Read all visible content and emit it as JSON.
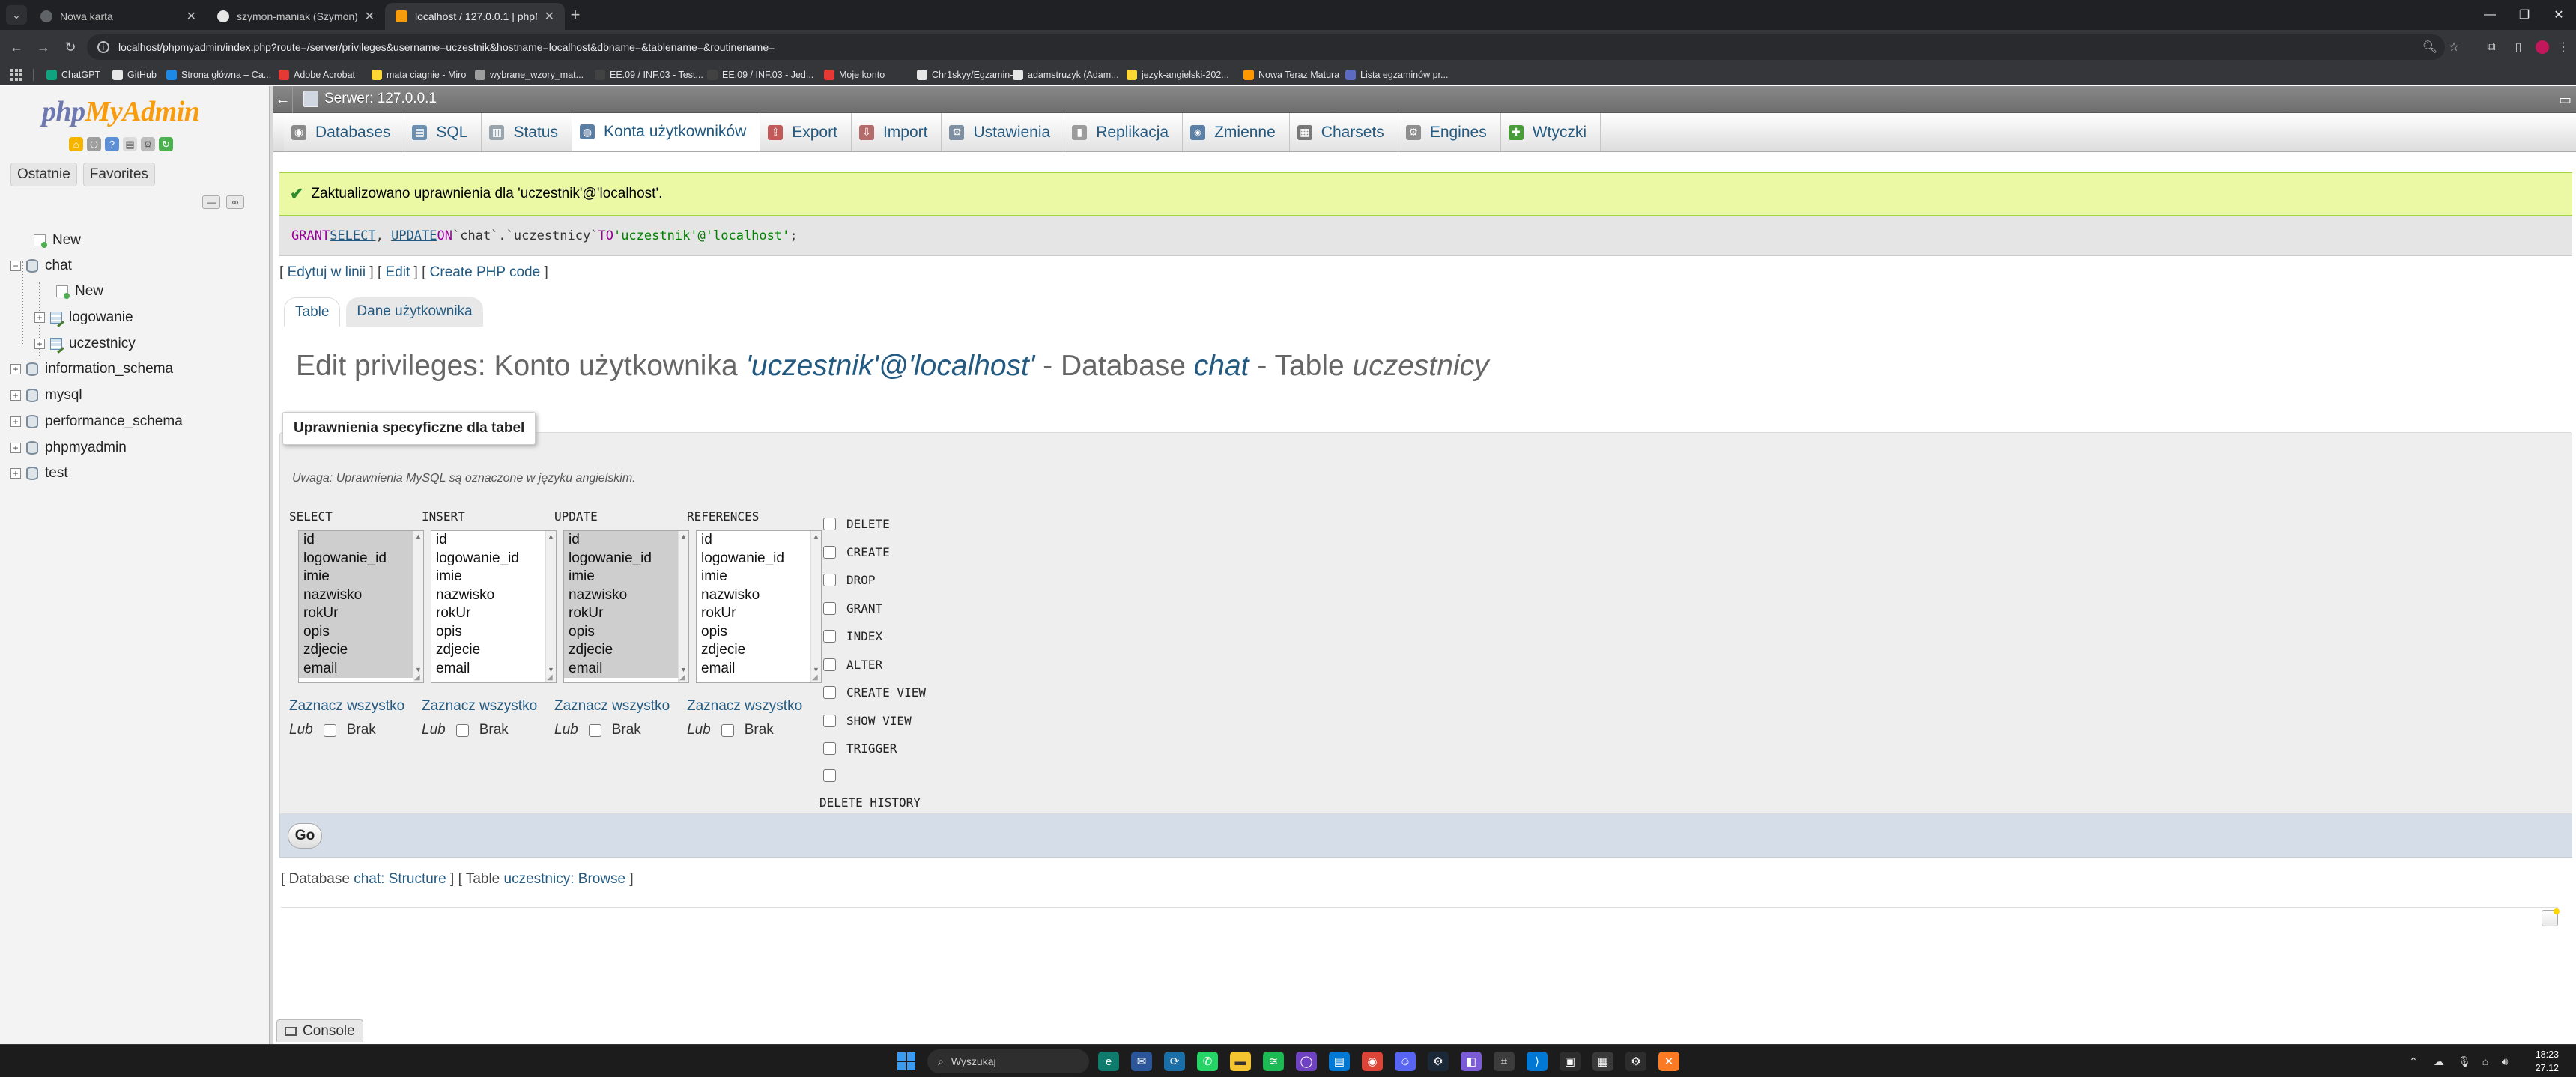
{
  "browser": {
    "tabs": [
      {
        "title": "Nowa karta",
        "active": false
      },
      {
        "title": "szymon-maniak (Szymon)",
        "active": false
      },
      {
        "title": "localhost / 127.0.0.1 | phpMy...",
        "active": true
      }
    ],
    "url": "localhost/phpmyadmin/index.php?route=/server/privileges&username=uczestnik&hostname=localhost&dbname=&tablename=&routinename=",
    "bookmarks": [
      {
        "label": "ChatGPT",
        "color": "#10a37f"
      },
      {
        "label": "GitHub",
        "color": "#e6e6e6"
      },
      {
        "label": "Strona główna – Ca...",
        "color": "#1e88e5"
      },
      {
        "label": "Adobe Acrobat",
        "color": "#e53935"
      },
      {
        "label": "mata ciagnie - Miro",
        "color": "#fdd835"
      },
      {
        "label": "wybrane_wzory_mat...",
        "color": "#9e9e9e"
      },
      {
        "label": "EE.09 / INF.03 - Test...",
        "color": "#424242"
      },
      {
        "label": "EE.09 / INF.03 - Jed...",
        "color": "#424242"
      },
      {
        "label": "Moje konto",
        "color": "#e53935"
      },
      {
        "label": "Chr1skyy/Egzamin-...",
        "color": "#e6e6e6"
      },
      {
        "label": "adamstruzyk (Adam...",
        "color": "#e6e6e6"
      },
      {
        "label": "jezyk-angielski-202...",
        "color": "#fdd835"
      },
      {
        "label": "Nowa Teraz Matura",
        "color": "#ff9800"
      },
      {
        "label": "Lista egzaminów pr...",
        "color": "#5c6bc0"
      }
    ]
  },
  "nav": {
    "logo_php": "php",
    "logo_myadmin": "MyAdmin",
    "recent_label": "Ostatnie",
    "favorites_label": "Favorites",
    "tree": {
      "new": "New",
      "chat": "chat",
      "chat_new": "New",
      "logowanie": "logowanie",
      "uczestnicy": "uczestnicy",
      "information_schema": "information_schema",
      "mysql": "mysql",
      "performance_schema": "performance_schema",
      "phpmyadmin": "phpmyadmin",
      "test": "test"
    }
  },
  "main": {
    "server": "Serwer: 127.0.0.1",
    "menu": [
      {
        "label": "Databases",
        "icon": "database-icon"
      },
      {
        "label": "SQL",
        "icon": "sql-icon"
      },
      {
        "label": "Status",
        "icon": "status-icon"
      },
      {
        "label": "Konta użytkowników",
        "icon": "users-icon"
      },
      {
        "label": "Export",
        "icon": "export-icon"
      },
      {
        "label": "Import",
        "icon": "import-icon"
      },
      {
        "label": "Ustawienia",
        "icon": "settings-icon"
      },
      {
        "label": "Replikacja",
        "icon": "replication-icon"
      },
      {
        "label": "Zmienne",
        "icon": "variables-icon"
      },
      {
        "label": "Charsets",
        "icon": "charsets-icon"
      },
      {
        "label": "Engines",
        "icon": "engines-icon"
      },
      {
        "label": "Wtyczki",
        "icon": "plugins-icon"
      }
    ],
    "success": "Zaktualizowano uprawnienia dla 'uczestnik'@'localhost'.",
    "sql": {
      "grant": "GRANT",
      "select": "SELECT",
      "comma": ", ",
      "update": "UPDATE",
      "on": "ON",
      "target": "`chat`.`uczestnicy`",
      "to": "TO",
      "user": "'uczestnik'@'localhost'",
      "end": ";"
    },
    "sql_links": {
      "edit_inline": "Edytuj w linii",
      "edit": "Edit",
      "create_php": "Create PHP code"
    },
    "subtabs": [
      "Table",
      "Dane użytkownika"
    ],
    "title": {
      "prefix": "Edit privileges: Konto użytkownika ",
      "user": "'uczestnik'@'localhost'",
      "mid1": " - Database ",
      "db": "chat",
      "mid2": " - Table ",
      "table": "uczestnicy"
    },
    "legend": "Uprawnienia specyficzne dla tabel",
    "note": "Uwaga: Uprawnienia MySQL są oznaczone w języku angielskim.",
    "columns": [
      "id",
      "logowanie_id",
      "imie",
      "nazwisko",
      "rokUr",
      "opis",
      "zdjecie",
      "email"
    ],
    "priv_columns": [
      {
        "label": "SELECT",
        "selected": true
      },
      {
        "label": "INSERT",
        "selected": false
      },
      {
        "label": "UPDATE",
        "selected": true
      },
      {
        "label": "REFERENCES",
        "selected": false
      }
    ],
    "select_all": "Zaznacz wszystko",
    "or": "Lub",
    "none": "Brak",
    "privileges": [
      "DELETE",
      "CREATE",
      "DROP",
      "GRANT",
      "INDEX",
      "ALTER",
      "CREATE VIEW",
      "SHOW VIEW",
      "TRIGGER",
      "",
      "DELETE HISTORY"
    ],
    "go": "Go",
    "bottom": {
      "db_prefix": "Database ",
      "db_link": "chat: Structure",
      "tbl_prefix": "Table ",
      "tbl_link": "uczestnicy: Browse"
    },
    "console": "Console"
  },
  "taskbar": {
    "search": "Wyszukaj",
    "time": "18:23",
    "date": "27.12"
  }
}
